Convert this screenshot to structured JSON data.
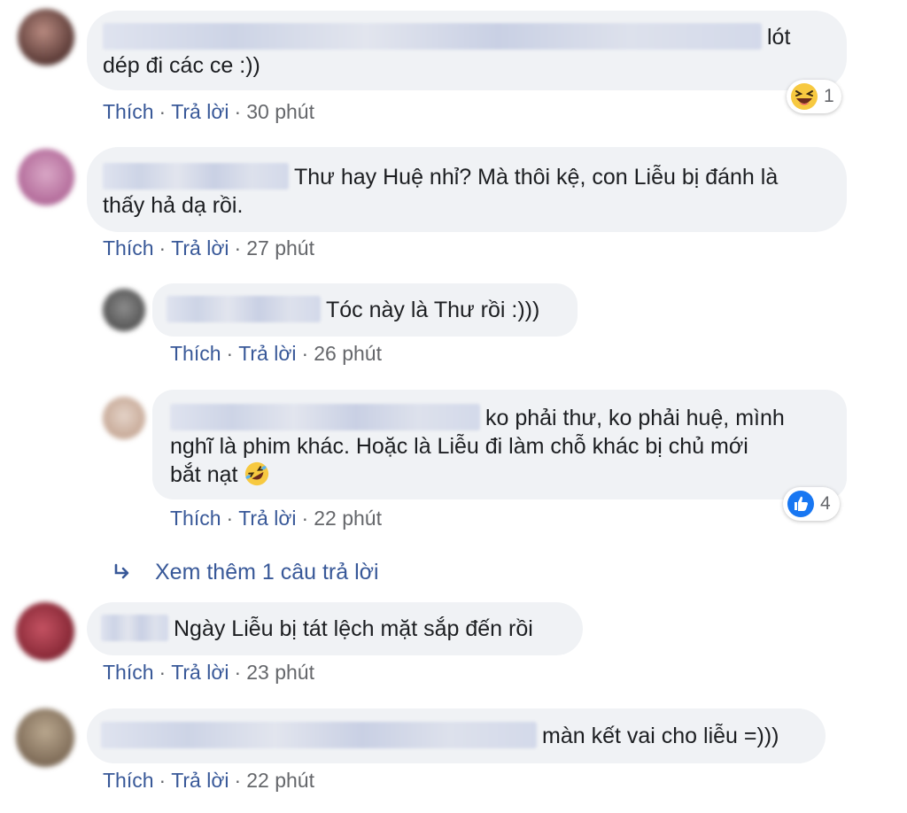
{
  "actions": {
    "like": "Thích",
    "reply": "Trả lời",
    "sep": "·"
  },
  "comments": [
    {
      "text": "lót dép đi các ce :))",
      "line1": "lót",
      "line2": "dép đi các ce :))",
      "time": "30 phút",
      "reaction": {
        "icon": "laugh-squint-emoji-icon",
        "count": "1"
      }
    },
    {
      "text": "Thư hay Huệ nhỉ? Mà thôi kệ, con Liễu bị đánh là thấy hả dạ rồi.",
      "line1": "Thư hay Huệ nhỉ? Mà thôi kệ, con Liễu bị đánh là",
      "line2": "thấy hả dạ rồi.",
      "time": "27 phút"
    },
    {
      "text": "Tóc này là Thư rồi :)))",
      "time": "26 phút"
    },
    {
      "line1": "ko phải thư, ko phải huệ, mình",
      "line2": "nghĩ là phim khác. Hoặc là Liễu đi làm chỗ khác bị chủ mới",
      "line3": "bắt nạt",
      "time": "22 phút",
      "reaction": {
        "icon": "like-thumb-icon",
        "count": "4"
      }
    },
    {
      "text": "Ngày Liễu bị tát lệch mặt sắp đến rồi",
      "time": "23 phút"
    },
    {
      "text": "màn kết vai cho liễu =)))",
      "time": "22 phút"
    }
  ],
  "view_more": {
    "label": "Xem thêm 1 câu trả lời",
    "icon": "reply-arrow-icon"
  },
  "colors": {
    "bubble": "#f0f2f5",
    "link": "#385898",
    "meta": "#65676b",
    "like_blue": "#1877f2"
  }
}
